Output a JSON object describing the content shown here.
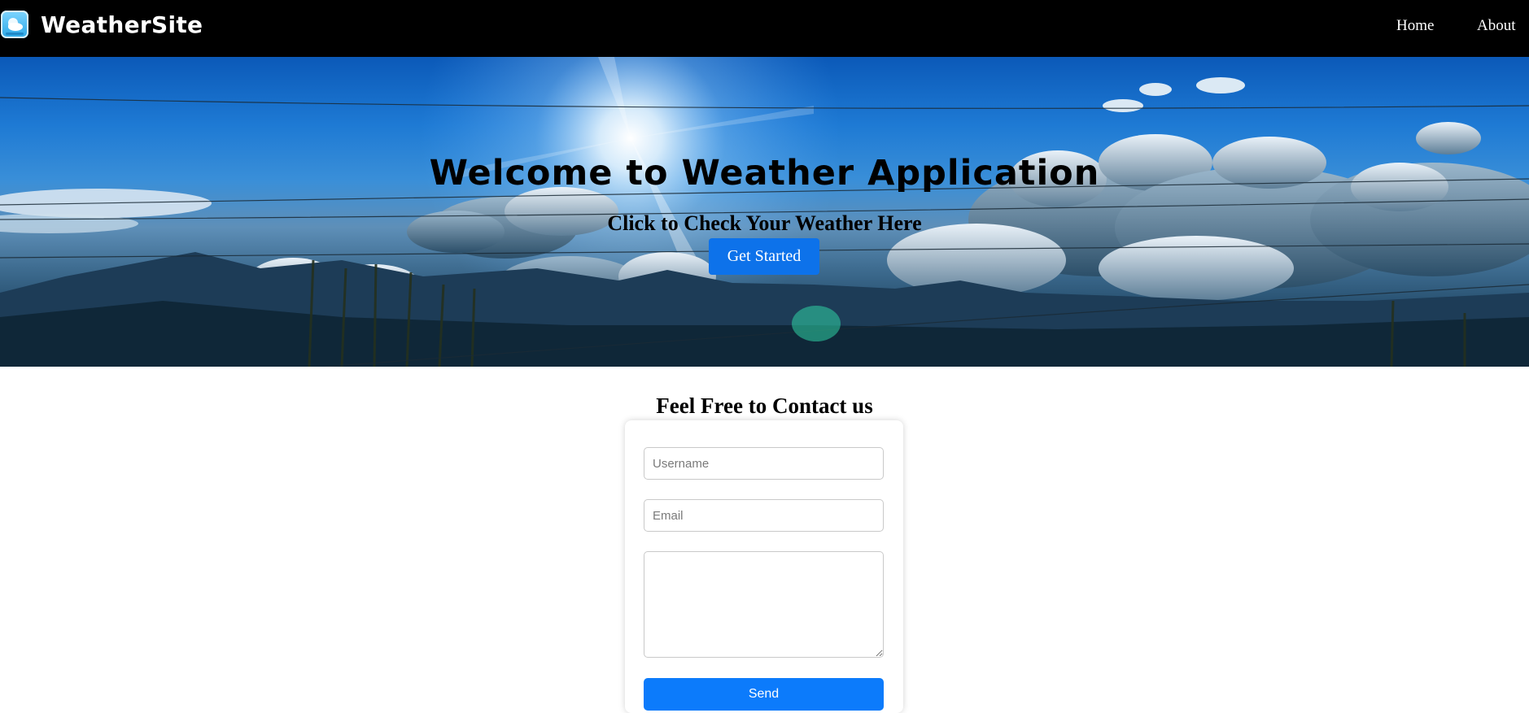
{
  "navbar": {
    "logo_icon": "weather-app-icon",
    "brand": "WeatherSite",
    "links": [
      {
        "label": "Home"
      },
      {
        "label": "About"
      }
    ]
  },
  "hero": {
    "title": "Welcome to Weather Application",
    "subtitle": "Click to Check Your Weather Here",
    "button_label": "Get Started"
  },
  "contact": {
    "heading": "Feel Free to Contact us",
    "username_placeholder": "Username",
    "email_placeholder": "Email",
    "message_placeholder": "",
    "send_label": "Send"
  },
  "colors": {
    "navbar_bg": "#000000",
    "primary_button": "#0c7bfb",
    "hero_button": "#0d72ea"
  }
}
